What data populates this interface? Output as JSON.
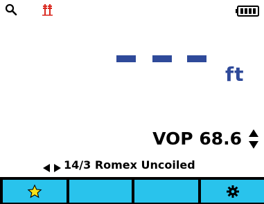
{
  "status_bar": {
    "icons": [
      "search-icon",
      "probe-leads-icon",
      "battery-icon"
    ],
    "colors": {
      "probe": "#d9261c"
    }
  },
  "measurement": {
    "value_display": "- - -",
    "unit": "ft",
    "color": "#2f4a9a"
  },
  "vop": {
    "label": "VOP",
    "value": "68.6",
    "text": "VOP 68.6"
  },
  "cable": {
    "selector_icon": "left-right-arrows-icon",
    "type": "14/3 Romex Uncoiled"
  },
  "softkeys": [
    {
      "icon": "star-icon",
      "label": ""
    },
    {
      "icon": "",
      "label": ""
    },
    {
      "icon": "",
      "label": ""
    },
    {
      "icon": "gear-icon",
      "label": ""
    }
  ],
  "colors": {
    "softkey_bg": "#29c3ec",
    "star": "#f7e21a"
  }
}
